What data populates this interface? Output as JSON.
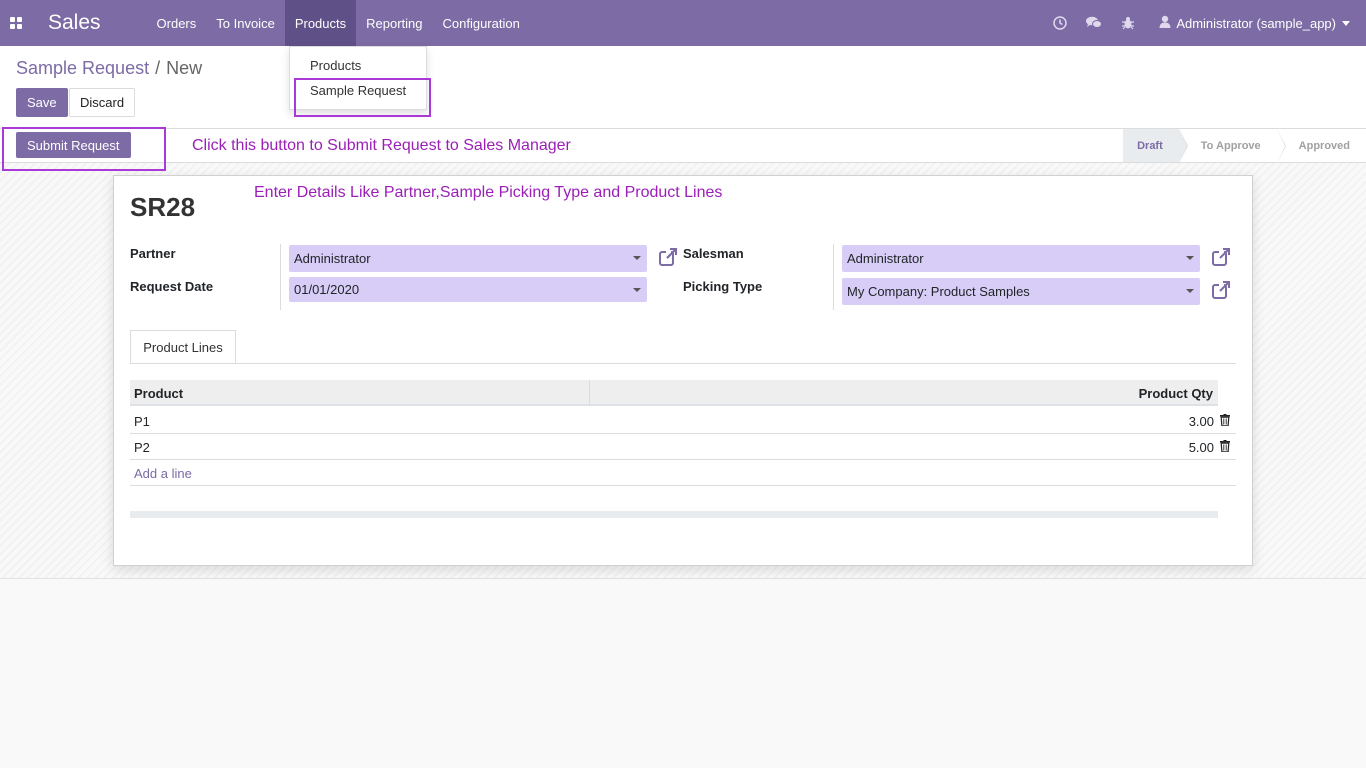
{
  "navbar": {
    "brand": "Sales",
    "menu": [
      "Orders",
      "To Invoice",
      "Products",
      "Reporting",
      "Configuration"
    ],
    "active_menu": "Products",
    "user": "Administrator (sample_app)",
    "color": "#7c6ba4"
  },
  "dropdown": {
    "items": [
      "Products",
      "Sample Request"
    ]
  },
  "breadcrumb": {
    "parent": "Sample Request",
    "separator": "/",
    "current": "New"
  },
  "buttons": {
    "save": "Save",
    "discard": "Discard",
    "submit": "Submit Request"
  },
  "annotations": {
    "submit_hint": "Click this button to Submit Request to Sales Manager",
    "details_hint": "Enter Details Like Partner,Sample Picking Type and Product Lines"
  },
  "statusbar": {
    "stages": [
      "Draft",
      "To Approve",
      "Approved"
    ],
    "active_stage": "Draft"
  },
  "form": {
    "name": "SR28",
    "partner_label": "Partner",
    "partner_value": "Administrator",
    "request_date_label": "Request Date",
    "request_date_value": "01/01/2020",
    "salesman_label": "Salesman",
    "salesman_value": "Administrator",
    "picking_type_label": "Picking Type",
    "picking_type_value": "My Company: Product Samples"
  },
  "tabs": [
    "Product Lines"
  ],
  "product_lines": {
    "columns": [
      "Product",
      "Product Qty"
    ],
    "rows": [
      {
        "product": "P1",
        "qty": "3.00"
      },
      {
        "product": "P2",
        "qty": "5.00"
      }
    ],
    "add_line": "Add a line"
  }
}
